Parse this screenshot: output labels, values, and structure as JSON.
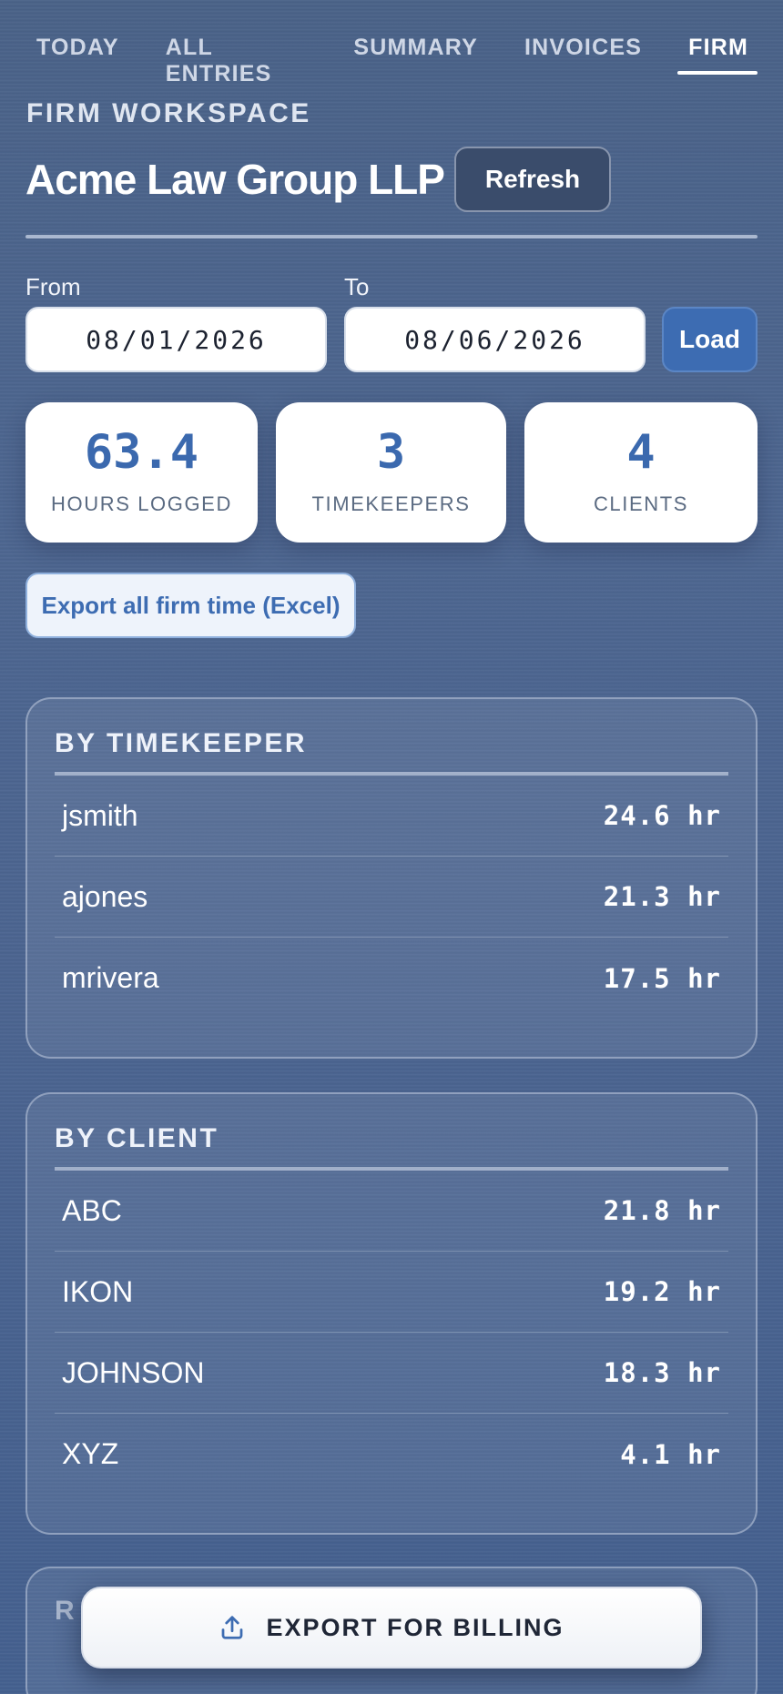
{
  "nav": {
    "tabs": [
      {
        "label": "TODAY",
        "active": false
      },
      {
        "label": "ALL ENTRIES",
        "active": false
      },
      {
        "label": "SUMMARY",
        "active": false
      },
      {
        "label": "INVOICES",
        "active": false
      },
      {
        "label": "FIRM",
        "active": true
      }
    ]
  },
  "header": {
    "eyebrow": "FIRM WORKSPACE",
    "firm_name": "Acme Law Group LLP",
    "refresh_label": "Refresh"
  },
  "date_range": {
    "from_label": "From",
    "from_value": "08/01/2026",
    "to_label": "To",
    "to_value": "08/06/2026",
    "load_label": "Load"
  },
  "stats": [
    {
      "value": "63.4",
      "label": "HOURS LOGGED"
    },
    {
      "value": "3",
      "label": "TIMEKEEPERS"
    },
    {
      "value": "4",
      "label": "CLIENTS"
    }
  ],
  "export_excel_label": "Export all firm time (Excel)",
  "by_timekeeper": {
    "title": "BY TIMEKEEPER",
    "rows": [
      {
        "name": "jsmith",
        "hours": "24.6 hr"
      },
      {
        "name": "ajones",
        "hours": "21.3 hr"
      },
      {
        "name": "mrivera",
        "hours": "17.5 hr"
      }
    ]
  },
  "by_client": {
    "title": "BY CLIENT",
    "rows": [
      {
        "name": "ABC",
        "hours": "21.8 hr"
      },
      {
        "name": "IKON",
        "hours": "19.2 hr"
      },
      {
        "name": "JOHNSON",
        "hours": "18.3 hr"
      },
      {
        "name": "XYZ",
        "hours": "4.1 hr"
      }
    ]
  },
  "third_panel": {
    "title_partial": "R"
  },
  "billing": {
    "label": "EXPORT FOR BILLING",
    "icon": "upload-icon"
  },
  "colors": {
    "accent": "#3d6cb2",
    "background": "#4b6490",
    "card": "#ffffff"
  }
}
